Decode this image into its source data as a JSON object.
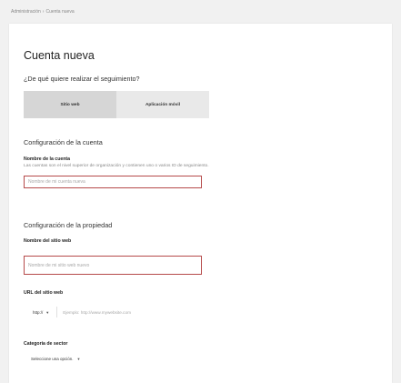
{
  "breadcrumb": {
    "items": [
      "Administración",
      "Cuenta nueva"
    ],
    "separator": "›"
  },
  "page": {
    "title": "Cuenta nueva",
    "question": "¿De qué quiere realizar el seguimiento?",
    "tabs": [
      {
        "label": "Sitio web",
        "selected": true
      },
      {
        "label": "Aplicación móvil",
        "selected": false
      }
    ]
  },
  "account_settings": {
    "heading": "Configuración de la cuenta",
    "name_label": "Nombre de la cuenta",
    "name_help": "Las cuentas son el nivel superior de organización y contienen uno o varios ID de seguimiento.",
    "name_placeholder": "Nombre de mi cuenta nueva"
  },
  "property_settings": {
    "heading": "Configuración de la propiedad",
    "site_name_label": "Nombre del sitio web",
    "site_name_placeholder": "Nombre de mi sitio web nuevo",
    "url_label": "URL del sitio web",
    "protocol_value": "http://",
    "url_placeholder": "Ejemplo: http://www.mywebsite.com",
    "category_label": "Categoría de sector",
    "category_value": "Seleccione una opción."
  },
  "icons": {
    "dropdown_caret": "▼"
  },
  "colors": {
    "input_border_error": "#b64a4a",
    "background": "#f1f1f1",
    "selected_tab": "#d6d6d6"
  }
}
